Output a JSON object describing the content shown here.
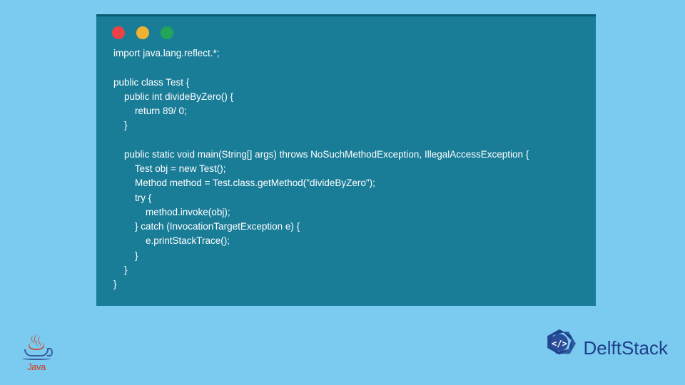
{
  "code": {
    "lines": [
      "import java.lang.reflect.*;",
      "",
      "public class Test {",
      "    public int divideByZero() {",
      "        return 89/ 0;",
      "    }",
      "",
      "    public static void main(String[] args) throws NoSuchMethodException, IllegalAccessException {",
      "        Test obj = new Test();",
      "        Method method = Test.class.getMethod(\"divideByZero\");",
      "        try {",
      "            method.invoke(obj);",
      "        } catch (InvocationTargetException e) {",
      "            e.printStackTrace();",
      "        }",
      "    }",
      "}"
    ]
  },
  "logos": {
    "java_label": "Java",
    "delft_label": "DelftStack"
  },
  "traffic": {
    "red": "close-icon",
    "yellow": "minimize-icon",
    "green": "maximize-icon"
  }
}
